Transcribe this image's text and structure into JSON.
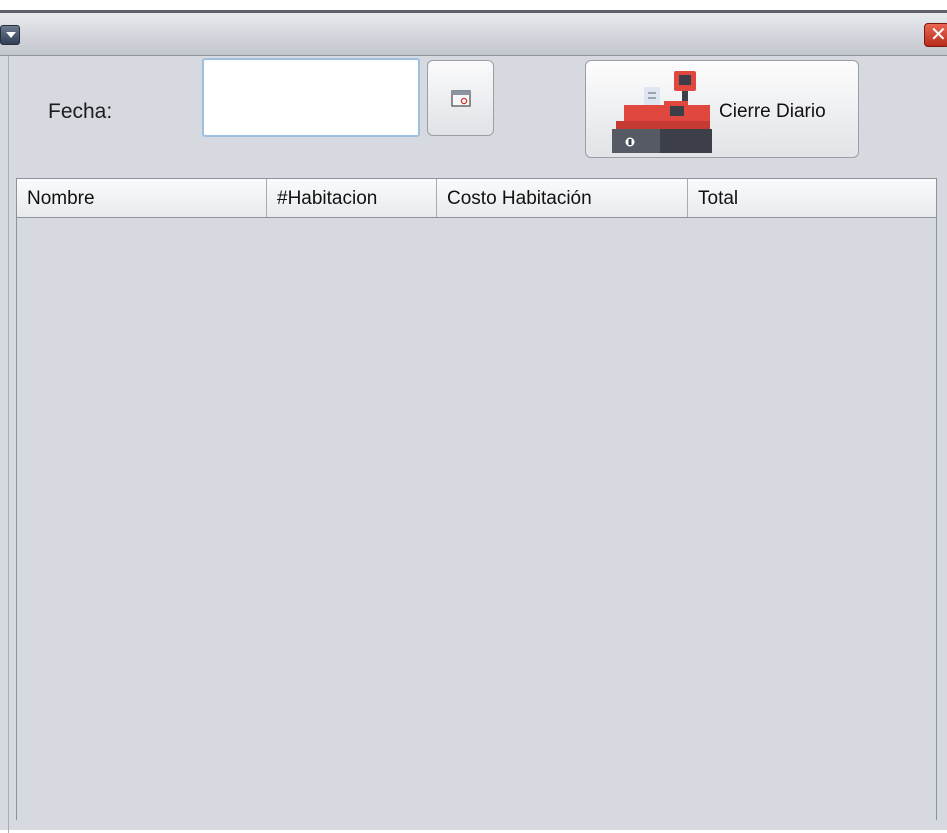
{
  "window": {
    "menu_icon": "menu-dropdown-icon",
    "close_icon": "close-icon",
    "close_label": "✕"
  },
  "form": {
    "date_label": "Fecha:",
    "date_value": "",
    "calendar_icon": "calendar-icon",
    "daily_close_label": "Cierre Diario",
    "daily_close_icon": "cash-register-icon"
  },
  "table": {
    "columns": [
      "Nombre",
      "#Habitacion",
      "Costo Habitación",
      "Total"
    ],
    "rows": []
  },
  "colors": {
    "background": "#d6d9df",
    "close_red": "#c8382a",
    "register_red": "#e0473f",
    "register_dark": "#3c3f48",
    "input_border": "#9fbfe0"
  }
}
